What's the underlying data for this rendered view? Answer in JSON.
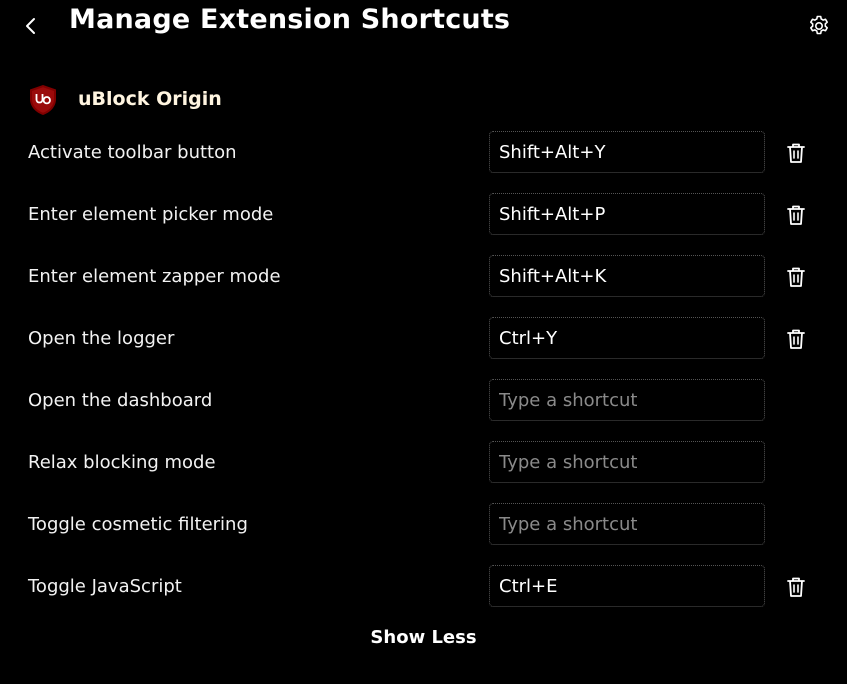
{
  "header": {
    "title": "Manage Extension Shortcuts",
    "back_icon": "chevron-left-icon",
    "settings_icon": "gear-icon"
  },
  "extension": {
    "name": "uBlock Origin",
    "logo_text": "uo",
    "logo_color": "#800000"
  },
  "shortcuts": [
    {
      "label": "Activate toolbar button",
      "value": "Shift+Alt+Y",
      "placeholder": "Type a shortcut"
    },
    {
      "label": "Enter element picker mode",
      "value": "Shift+Alt+P",
      "placeholder": "Type a shortcut"
    },
    {
      "label": "Enter element zapper mode",
      "value": "Shift+Alt+K",
      "placeholder": "Type a shortcut"
    },
    {
      "label": "Open the logger",
      "value": "Ctrl+Y",
      "placeholder": "Type a shortcut"
    },
    {
      "label": "Open the dashboard",
      "value": "",
      "placeholder": "Type a shortcut"
    },
    {
      "label": "Relax blocking mode",
      "value": "",
      "placeholder": "Type a shortcut"
    },
    {
      "label": "Toggle cosmetic filtering",
      "value": "",
      "placeholder": "Type a shortcut"
    },
    {
      "label": "Toggle JavaScript",
      "value": "Ctrl+E",
      "placeholder": "Type a shortcut"
    }
  ],
  "delete_icon": "trash-icon",
  "footer": {
    "show_less_label": "Show Less"
  }
}
